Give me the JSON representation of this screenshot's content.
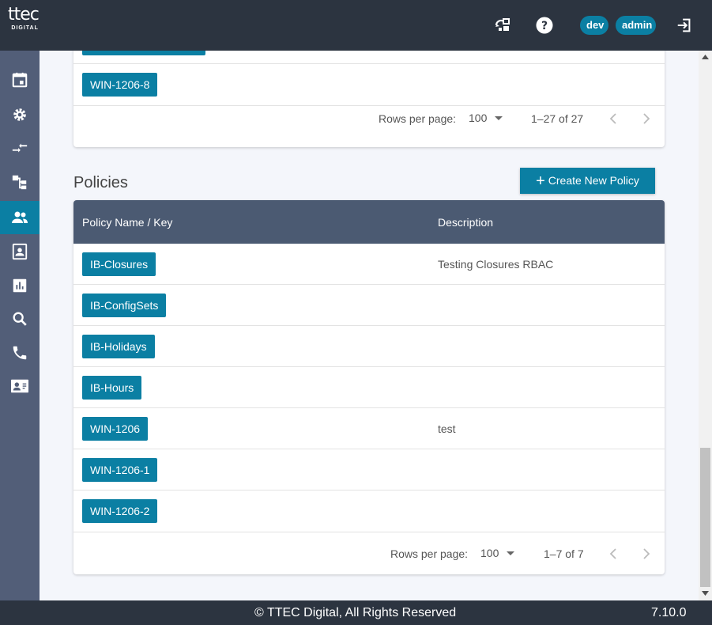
{
  "header": {
    "logo_word": "ttec",
    "logo_sub": "DIGITAL",
    "env_badge": "dev",
    "user_badge": "admin"
  },
  "sidebar": {
    "items": [
      {
        "icon": "calendar-icon"
      },
      {
        "icon": "gear-icon"
      },
      {
        "icon": "transfer-arrows-icon"
      },
      {
        "icon": "hierarchy-icon"
      },
      {
        "icon": "people-icon",
        "active": true
      },
      {
        "icon": "contact-card-icon"
      },
      {
        "icon": "bar-chart-icon"
      },
      {
        "icon": "search-icon"
      },
      {
        "icon": "phone-icon"
      },
      {
        "icon": "id-card-icon"
      }
    ]
  },
  "top_table": {
    "visible_item": "WIN-1206-8",
    "rows_per_page_label": "Rows per page:",
    "rows_per_page_value": "100",
    "range": "1–27 of 27"
  },
  "policies": {
    "title": "Policies",
    "create_button": "Create New Policy",
    "columns": [
      "Policy Name / Key",
      "Description"
    ],
    "rows": [
      {
        "name": "IB-Closures",
        "description": "Testing Closures RBAC"
      },
      {
        "name": "IB-ConfigSets",
        "description": ""
      },
      {
        "name": "IB-Holidays",
        "description": ""
      },
      {
        "name": "IB-Hours",
        "description": ""
      },
      {
        "name": "WIN-1206",
        "description": "test"
      },
      {
        "name": "WIN-1206-1",
        "description": ""
      },
      {
        "name": "WIN-1206-2",
        "description": ""
      }
    ],
    "rows_per_page_label": "Rows per page:",
    "rows_per_page_value": "100",
    "range": "1–7 of 7"
  },
  "footer": {
    "copyright": "© TTEC Digital, All Rights Reserved",
    "version": "7.10.0"
  },
  "colors": {
    "accent": "#0b7fa3",
    "topbar": "#2c3440",
    "sidebar": "#525e78",
    "table_header": "#4b5a72"
  }
}
